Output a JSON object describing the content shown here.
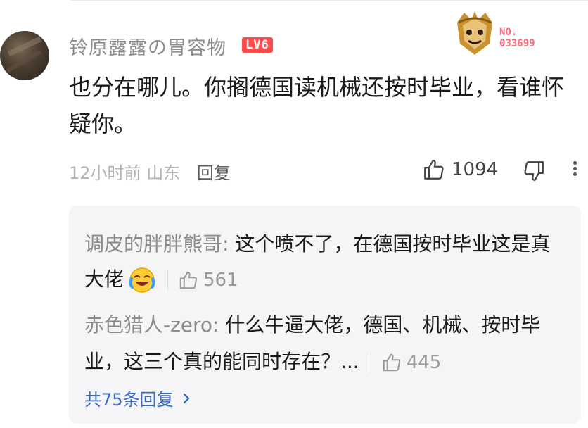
{
  "comment": {
    "username": "铃原露露の胃容物",
    "level": "LV6",
    "badge_number": "NO.\n033699",
    "content": "也分在哪儿。你搁德国读机械还按时毕业，看谁怀疑你。",
    "time": "12小时前",
    "location": "山东",
    "reply_label": "回复",
    "likes": "1094"
  },
  "replies": [
    {
      "username": "调皮的胖胖熊哥:",
      "text": " 这个喷不了，在德国按时毕业这是真大佬",
      "emoji": "laughing-crying-emoji",
      "likes": "561"
    },
    {
      "username": "赤色猎人-zero:",
      "text": " 什么牛逼大佬，德国、机械、按时毕业，这三个真的能同时存在？...",
      "likes": "445"
    }
  ],
  "total_replies": "共75条回复",
  "colors": {
    "level_badge": "#ff4d4f",
    "link": "#3a6bbf",
    "reply_bg": "#f5f5f7"
  }
}
